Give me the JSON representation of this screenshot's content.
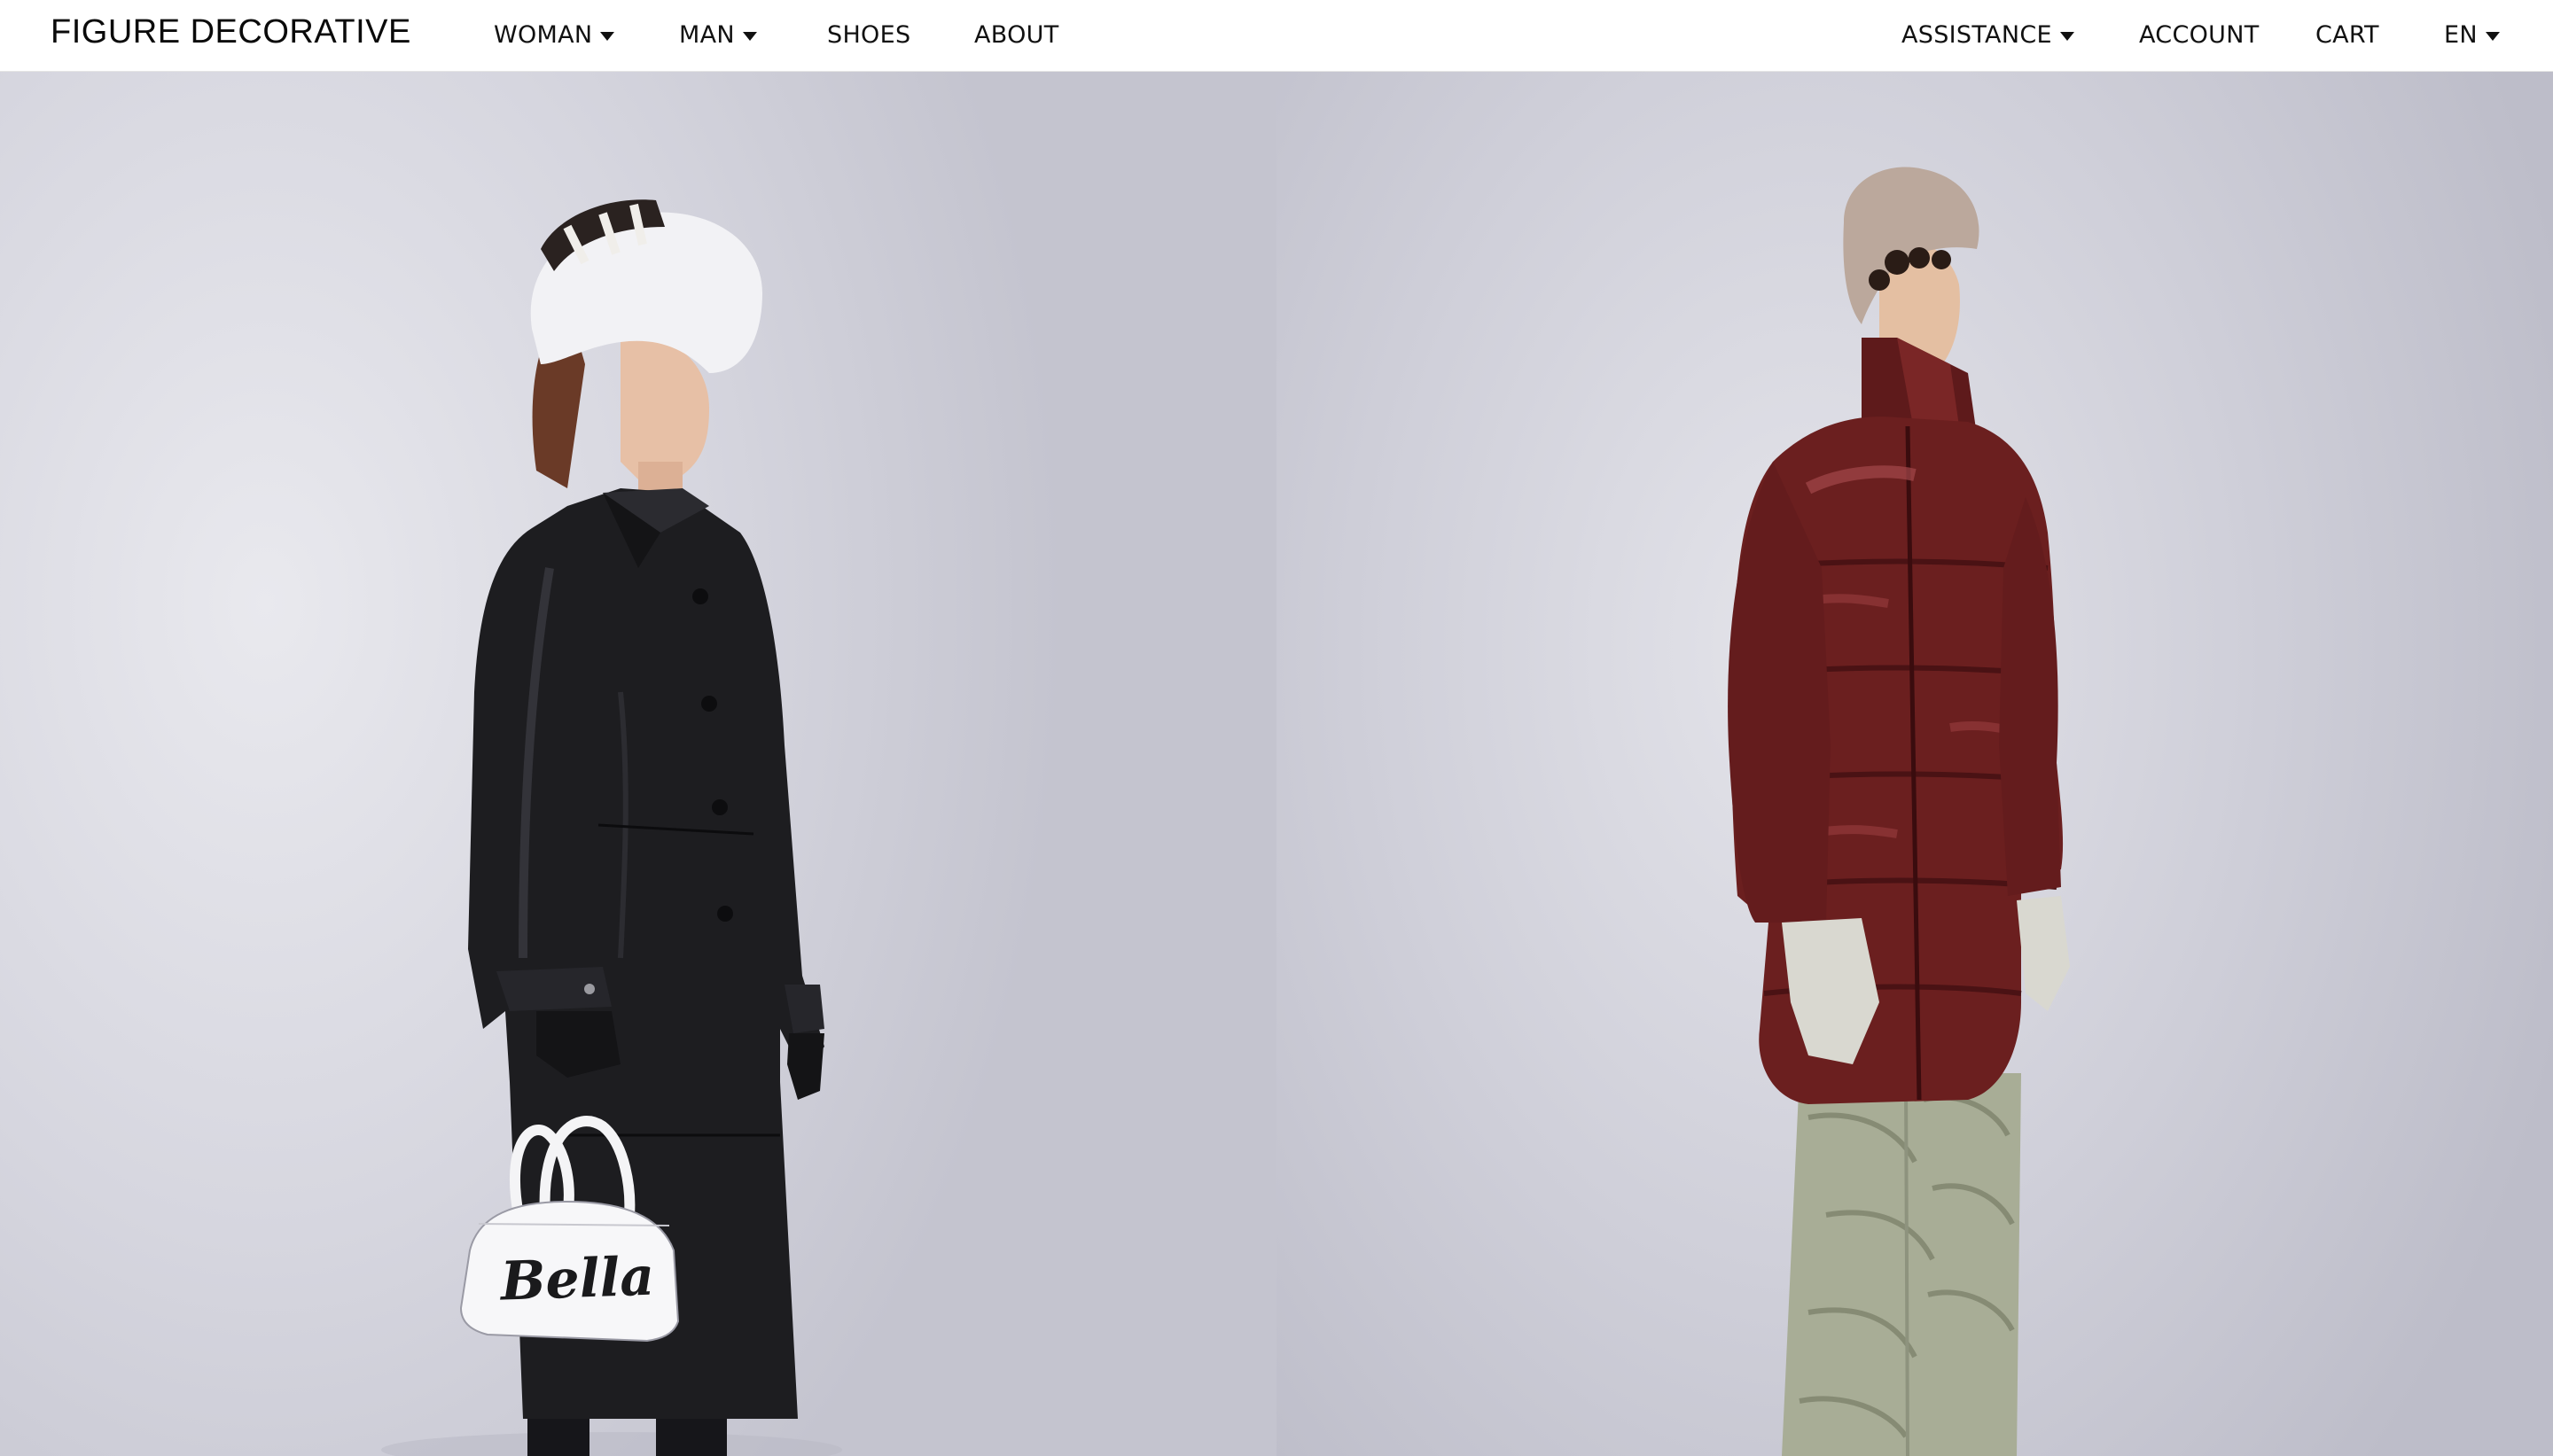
{
  "brand": {
    "name": "FIGURE DECORATIVE"
  },
  "nav_left": [
    {
      "label": "WOMAN",
      "dropdown": true
    },
    {
      "label": "MAN",
      "dropdown": true
    },
    {
      "label": "SHOES",
      "dropdown": false
    },
    {
      "label": "ABOUT",
      "dropdown": false
    }
  ],
  "nav_right": [
    {
      "label": "ASSISTANCE",
      "dropdown": true
    },
    {
      "label": "ACCOUNT",
      "dropdown": false
    },
    {
      "label": "CART",
      "dropdown": false
    },
    {
      "label": "EN",
      "dropdown": true
    }
  ],
  "hero": {
    "left_image": {
      "bag_text": "Bella"
    },
    "colors": {
      "coat": "#1d1d20",
      "puffer": "#6b1f1f",
      "backdrop": "#d2d2db"
    }
  },
  "icons": {
    "dropdown": "caret-down-icon"
  }
}
